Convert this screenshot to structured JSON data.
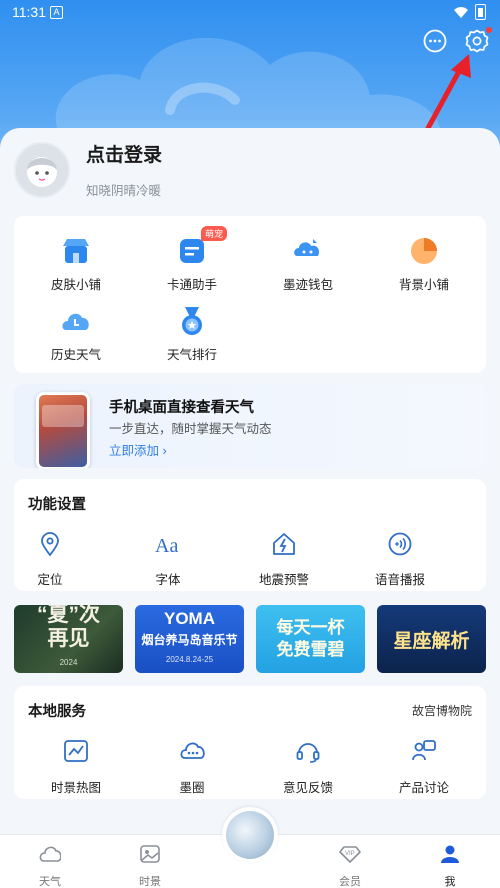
{
  "status_bar": {
    "time": "11:31",
    "app_icon_glyph": "A"
  },
  "header": {
    "icons": [
      "chat-bubble-icon",
      "settings-gear-icon"
    ],
    "settings_has_notification": true
  },
  "profile": {
    "login_label": "点击登录",
    "subtitle": "知晓阴晴冷暖"
  },
  "services": [
    {
      "label": "皮肤小铺",
      "icon": "shop-icon"
    },
    {
      "label": "卡通助手",
      "icon": "cartoon-assistant-icon",
      "badge": "萌宠"
    },
    {
      "label": "墨迹钱包",
      "icon": "wallet-icon"
    },
    {
      "label": "背景小铺",
      "icon": "background-shop-icon"
    },
    {
      "label": "历史天气",
      "icon": "history-weather-icon"
    },
    {
      "label": "天气排行",
      "icon": "ranking-medal-icon"
    }
  ],
  "promo": {
    "title": "手机桌面直接查看天气",
    "subtitle": "一步直达，随时掌握天气动态",
    "link": "立即添加 ›"
  },
  "functions": {
    "title": "功能设置",
    "items": [
      {
        "label": "定位",
        "icon": "location-pin-icon"
      },
      {
        "label": "字体",
        "icon": "font-icon"
      },
      {
        "label": "地震预警",
        "icon": "earthquake-alert-icon"
      },
      {
        "label": "语音播报",
        "icon": "voice-broadcast-icon"
      }
    ]
  },
  "banners": [
    {
      "text_line1": "“夏”次",
      "text_line2": "再见",
      "tag": "2024"
    },
    {
      "text_line1": "YOMA",
      "text_line2": "烟台养马岛音乐节",
      "tag": "2024.8.24-25"
    },
    {
      "text_line1": "每天一杯",
      "text_line2": "免费雪碧",
      "tag": ""
    },
    {
      "text_line1": "星座解析",
      "text_line2": "",
      "tag": ""
    }
  ],
  "local_services": {
    "title": "本地服务",
    "more": "故宫博物院",
    "items": [
      {
        "label": "时景热图",
        "icon": "heatmap-icon"
      },
      {
        "label": "墨圈",
        "icon": "cloud-circle-icon"
      },
      {
        "label": "意见反馈",
        "icon": "headset-icon"
      },
      {
        "label": "产品讨论",
        "icon": "discussion-icon"
      }
    ]
  },
  "tabs": [
    {
      "label": "天气",
      "icon": "cloud-icon",
      "active": false
    },
    {
      "label": "时景",
      "icon": "image-icon",
      "active": false
    },
    {
      "label": "会员",
      "icon": "vip-diamond-icon",
      "active": false
    },
    {
      "label": "我",
      "icon": "person-icon",
      "active": true
    }
  ],
  "colors": {
    "accent": "#2f7ee8",
    "hero_top": "#2f8ff0",
    "badge": "#ff5a4e",
    "annotation_arrow": "#e8202a"
  }
}
